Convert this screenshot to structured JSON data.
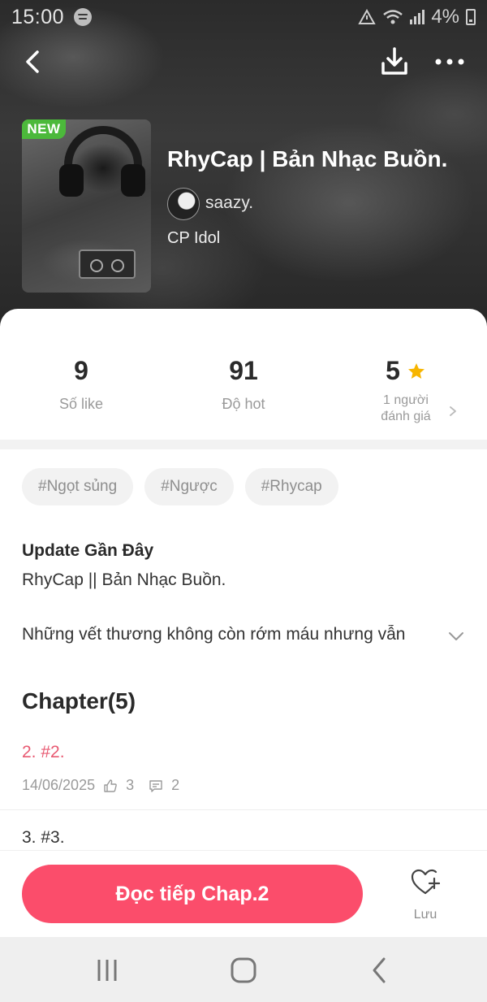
{
  "status_bar": {
    "time": "15:00",
    "battery": "4%"
  },
  "story": {
    "badge": "NEW",
    "title": "RhyCap | Bản Nhạc Buồn.",
    "author": "saazy.",
    "category": "CP Idol"
  },
  "stats": {
    "likes_value": "9",
    "likes_label": "Số like",
    "hot_value": "91",
    "hot_label": "Độ hot",
    "rating_value": "5",
    "rating_count_line1": "1 người",
    "rating_count_line2": "đánh giá"
  },
  "tags": [
    "#Ngọt sủng",
    "#Ngược",
    "#Rhycap"
  ],
  "update": {
    "heading": "Update Gần Đây",
    "title": "RhyCap || Bản Nhạc Buồn.",
    "summary": "Những vết thương không còn rớm máu nhưng vẫn"
  },
  "chapters": {
    "heading": "Chapter(5)",
    "items": [
      {
        "title": "2. #2.",
        "date": "14/06/2025",
        "likes": "3",
        "comments": "2",
        "highlighted": true
      },
      {
        "title": "3. #3."
      }
    ]
  },
  "actions": {
    "read_label": "Đọc tiếp Chap.2",
    "save_label": "Lưu"
  },
  "colors": {
    "accent": "#fb4d6b",
    "badge_green": "#4cb93b",
    "star": "#f7b500",
    "highlight_text": "#e85a72"
  },
  "icons": [
    "back-arrow-icon",
    "download-icon",
    "more-icon",
    "star-icon",
    "chevron-right-icon",
    "chevron-down-icon",
    "thumb-up-icon",
    "comment-icon",
    "heart-plus-icon",
    "recent-apps-icon",
    "home-icon",
    "back-icon"
  ]
}
